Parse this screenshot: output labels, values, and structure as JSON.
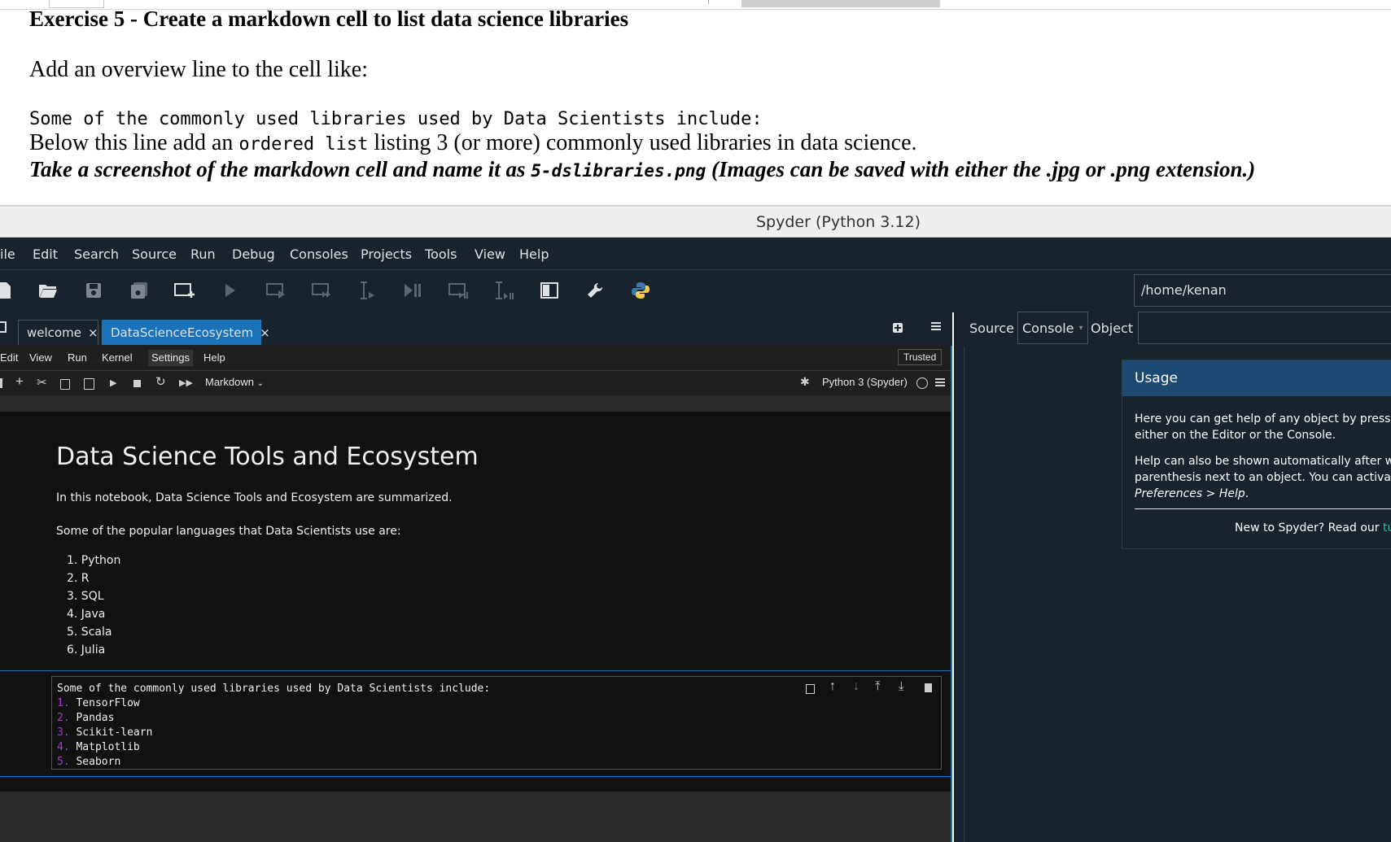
{
  "document": {
    "heading": "Exercise 5 - Create a markdown cell to list data science libraries",
    "instruction": "Add an overview line to the cell like:",
    "code_line": "Some of the commonly used libraries used by Data Scientists include:",
    "line3_part1": "Below this line add an ",
    "line3_code": "ordered list",
    "line3_part2": " listing 3 (or more) commonly used libraries in data science.",
    "line4_part1": "Take a screenshot of the markdown cell and name it as ",
    "line4_code": "5-dslibraries.png",
    "line4_part2": " (Images can be saved with either the .jpg or .png extension.)"
  },
  "window": {
    "title": "Spyder (Python 3.12)"
  },
  "menubar": [
    "ile",
    "Edit",
    "Search",
    "Source",
    "Run",
    "Debug",
    "Consoles",
    "Projects",
    "Tools",
    "View",
    "Help"
  ],
  "toolbar": {
    "icons": [
      "new-file-icon",
      "open-file-icon",
      "save-icon",
      "save-all-icon",
      "new-cell-icon",
      "run-icon",
      "run-cell-icon",
      "run-cell-advance-icon",
      "run-selection-icon",
      "debug-icon",
      "debug-cell-icon",
      "debug-selection-icon",
      "maximize-pane-icon",
      "preferences-icon",
      "python-path-icon"
    ],
    "working_dir": "/home/kenan"
  },
  "editor_tabs": [
    {
      "label": "welcome",
      "active": false
    },
    {
      "label": "DataScienceEcosystem",
      "active": true
    }
  ],
  "jupyter": {
    "menu": [
      "Edit",
      "View",
      "Run",
      "Kernel",
      "Settings",
      "Help"
    ],
    "trusted": "Trusted",
    "cell_type": "Markdown",
    "kernel": "Python 3 (Spyder)",
    "markdown_output": {
      "title": "Data Science Tools and Ecosystem",
      "intro": "In this notebook, Data Science Tools and Ecosystem are summarized.",
      "languages_intro": "Some of the popular languages that Data Scientists use are:",
      "languages": [
        "1. Python",
        "2. R",
        "3. SQL",
        "4. Java",
        "5. Scala",
        "6. Julia"
      ]
    },
    "active_cell": {
      "first_line": "Some of the commonly used libraries used by Data Scientists include:",
      "items": [
        {
          "num": "1.",
          "text": " TensorFlow"
        },
        {
          "num": "2.",
          "text": " Pandas"
        },
        {
          "num": "3.",
          "text": " Scikit-learn"
        },
        {
          "num": "4.",
          "text": " Matplotlib"
        },
        {
          "num": "5.",
          "text": " Seaborn"
        }
      ]
    }
  },
  "help_pane": {
    "tabs": [
      "Source",
      "Console",
      "Object"
    ],
    "usage_title": "Usage",
    "para1_line1": "Here you can get help of any object by pressi",
    "para1_line2": "either on the Editor or the Console.",
    "para2_line1": "Help can also be shown automatically after w",
    "para2_line2": "parenthesis next to an object. You can activat",
    "para2_line3": "Preferences > Help",
    "para2_line3_end": ".",
    "footer_text": "New to Spyder? Read our ",
    "footer_link": "tu"
  },
  "colors": {
    "spyder_bg": "#19232d",
    "accent": "#1a72bb",
    "usage_header": "#1d4a73",
    "list_number": "#a13dd1",
    "link": "#1dbfa0"
  }
}
